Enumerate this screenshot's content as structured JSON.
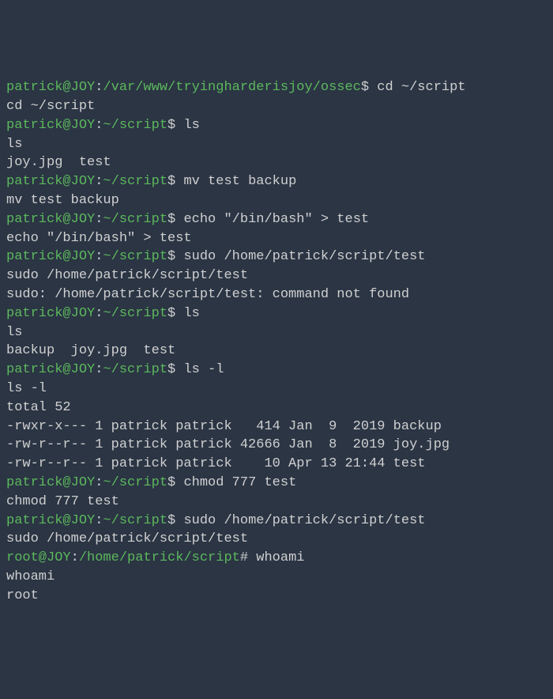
{
  "lines": [
    {
      "type": "prompt",
      "user": "patrick@JOY",
      "path": "/var/www/tryingharderisjoy/ossec",
      "symbol": "$",
      "cmd": "cd ~/script"
    },
    {
      "type": "output",
      "text": "cd ~/script"
    },
    {
      "type": "prompt",
      "user": "patrick@JOY",
      "path": "~/script",
      "symbol": "$",
      "cmd": "ls"
    },
    {
      "type": "output",
      "text": "ls"
    },
    {
      "type": "output",
      "text": "joy.jpg  test"
    },
    {
      "type": "prompt",
      "user": "patrick@JOY",
      "path": "~/script",
      "symbol": "$",
      "cmd": "mv test backup"
    },
    {
      "type": "output",
      "text": "mv test backup"
    },
    {
      "type": "prompt",
      "user": "patrick@JOY",
      "path": "~/script",
      "symbol": "$",
      "cmd": "echo \"/bin/bash\" > test"
    },
    {
      "type": "output",
      "text": "echo \"/bin/bash\" > test"
    },
    {
      "type": "prompt",
      "user": "patrick@JOY",
      "path": "~/script",
      "symbol": "$",
      "cmd": "sudo /home/patrick/script/test"
    },
    {
      "type": "output",
      "text": "sudo /home/patrick/script/test"
    },
    {
      "type": "output",
      "text": "sudo: /home/patrick/script/test: command not found"
    },
    {
      "type": "prompt",
      "user": "patrick@JOY",
      "path": "~/script",
      "symbol": "$",
      "cmd": "ls"
    },
    {
      "type": "output",
      "text": "ls"
    },
    {
      "type": "output",
      "text": "backup  joy.jpg  test"
    },
    {
      "type": "prompt",
      "user": "patrick@JOY",
      "path": "~/script",
      "symbol": "$",
      "cmd": "ls -l"
    },
    {
      "type": "output",
      "text": "ls -l"
    },
    {
      "type": "output",
      "text": "total 52"
    },
    {
      "type": "output",
      "text": "-rwxr-x--- 1 patrick patrick   414 Jan  9  2019 backup"
    },
    {
      "type": "output",
      "text": "-rw-r--r-- 1 patrick patrick 42666 Jan  8  2019 joy.jpg"
    },
    {
      "type": "output",
      "text": "-rw-r--r-- 1 patrick patrick    10 Apr 13 21:44 test"
    },
    {
      "type": "prompt",
      "user": "patrick@JOY",
      "path": "~/script",
      "symbol": "$",
      "cmd": "chmod 777 test"
    },
    {
      "type": "output",
      "text": "chmod 777 test"
    },
    {
      "type": "prompt",
      "user": "patrick@JOY",
      "path": "~/script",
      "symbol": "$",
      "cmd": "sudo /home/patrick/script/test"
    },
    {
      "type": "output",
      "text": "sudo /home/patrick/script/test"
    },
    {
      "type": "prompt",
      "user": "root@JOY",
      "path": "/home/patrick/script",
      "symbol": "#",
      "cmd": "whoami"
    },
    {
      "type": "output",
      "text": "whoami"
    },
    {
      "type": "output",
      "text": "root"
    }
  ]
}
